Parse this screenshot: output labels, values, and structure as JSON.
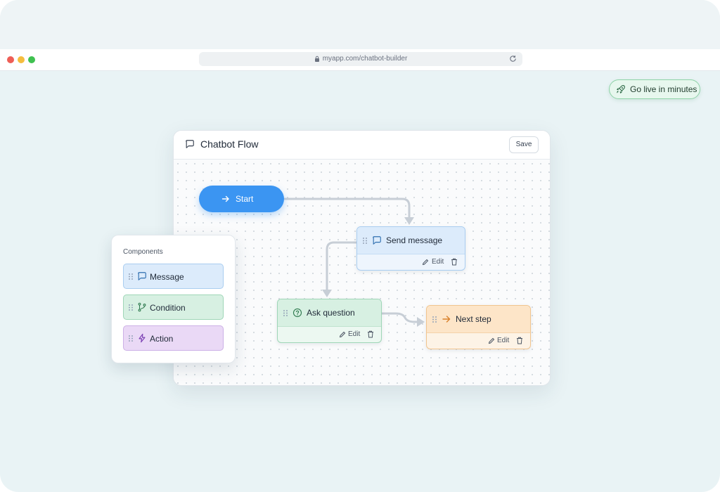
{
  "browser": {
    "url": "myapp.com/chatbot-builder"
  },
  "badge": {
    "label": "Go live in minutes"
  },
  "editor": {
    "title": "Chatbot Flow",
    "save_label": "Save"
  },
  "flow": {
    "start_label": "Start",
    "nodes": [
      {
        "label": "Send message",
        "edit_label": "Edit",
        "icon": "message-icon"
      },
      {
        "label": "Ask question",
        "edit_label": "Edit",
        "icon": "question-icon"
      },
      {
        "label": "Next step",
        "edit_label": "Edit",
        "icon": "arrow-right-icon"
      }
    ]
  },
  "components": {
    "heading": "Components",
    "items": [
      {
        "label": "Message",
        "icon": "message-icon"
      },
      {
        "label": "Condition",
        "icon": "branch-icon"
      },
      {
        "label": "Action",
        "icon": "lightning-icon"
      }
    ]
  },
  "colors": {
    "start": "#3b95f2",
    "message": "#dcebfb",
    "condition": "#d7f0e2",
    "action": "#ead9f6",
    "next_step": "#fde5c8",
    "go_live": "#e7f7ee"
  }
}
